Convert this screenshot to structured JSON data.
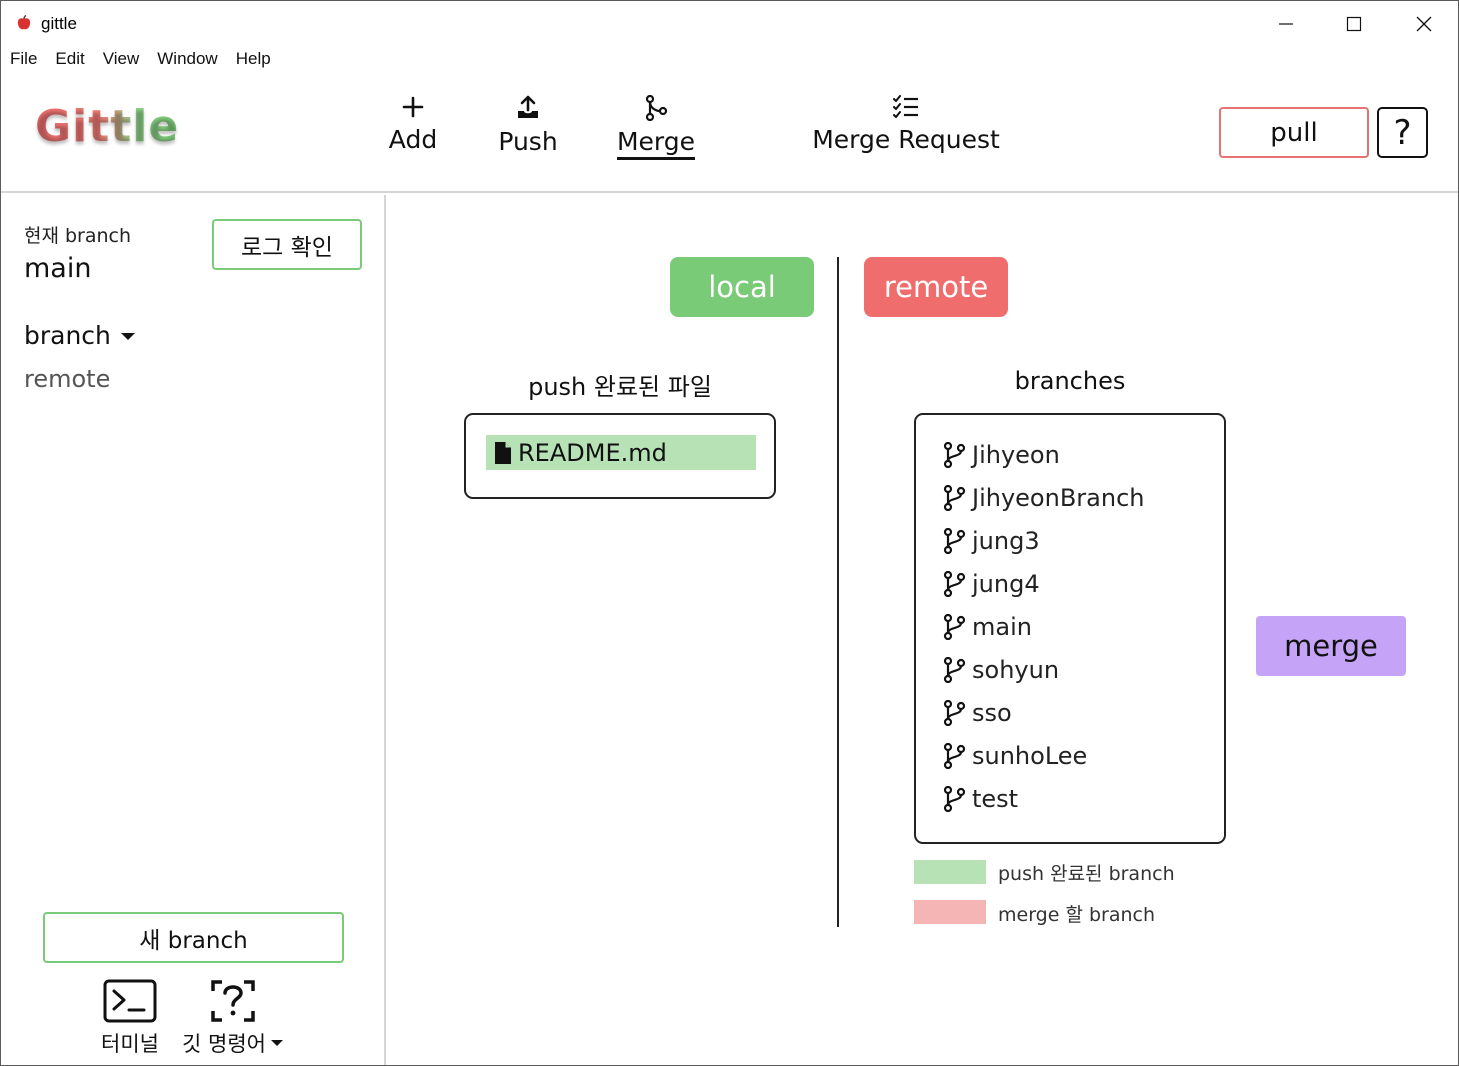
{
  "window": {
    "title": "gittle",
    "min_icon": "minimize-icon",
    "max_icon": "maximize-icon",
    "close_icon": "close-icon"
  },
  "menu": [
    "File",
    "Edit",
    "View",
    "Window",
    "Help"
  ],
  "header": {
    "logo": "Gittle",
    "tools": {
      "add": {
        "label": "Add",
        "icon": "plus-icon"
      },
      "push": {
        "label": "Push",
        "icon": "upload-icon"
      },
      "merge": {
        "label": "Merge",
        "icon": "git-merge-icon"
      },
      "merge_request": {
        "label": "Merge Request",
        "icon": "checklist-icon"
      }
    },
    "pull_label": "pull",
    "help_label": "?"
  },
  "sidebar": {
    "current_branch_label": "현재 branch",
    "current_branch": "main",
    "log_button": "로그 확인",
    "branch_toggle": "branch",
    "remote_link": "remote",
    "new_branch_button": "새 branch",
    "terminal_label": "터미널",
    "git_commands_label": "깃 명령어"
  },
  "main": {
    "local_label": "local",
    "remote_label": "remote",
    "pushed_title": "push 완료된 파일",
    "pushed_files": [
      "README.md"
    ],
    "branches_title": "branches",
    "branches": [
      "Jihyeon",
      "JihyeonBranch",
      "jung3",
      "jung4",
      "main",
      "sohyun",
      "sso",
      "sunhoLee",
      "test"
    ],
    "merge_button": "merge",
    "legend": {
      "pushed": "push 완료된 branch",
      "merge": "merge 할 branch"
    }
  },
  "colors": {
    "green": "#7acb77",
    "red": "#ef6d6d",
    "purple": "#c5a4f7",
    "pushed_highlight": "#b7e2b6",
    "merge_highlight": "#f6b5b5"
  }
}
